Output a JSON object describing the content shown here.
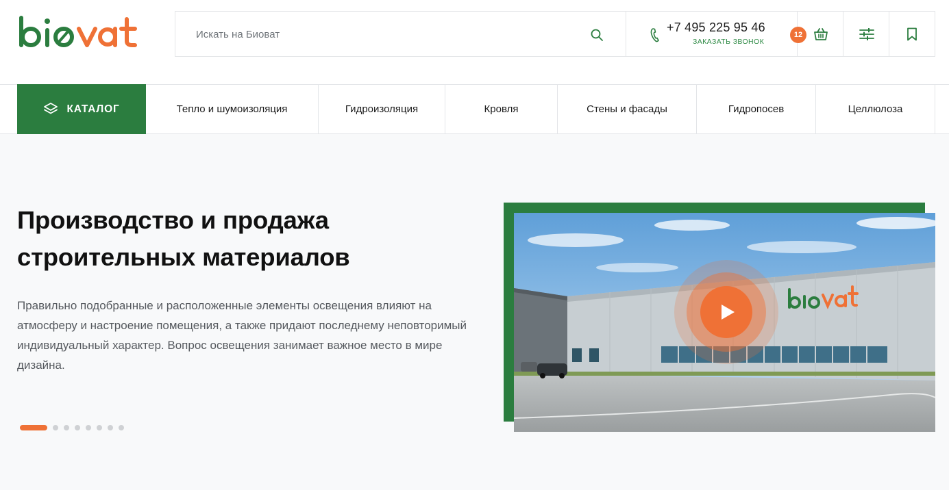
{
  "brand": {
    "logo_text": "biovat",
    "green": "#2b7d3f",
    "orange": "#ef7136"
  },
  "search": {
    "placeholder": "Искать на Биоват",
    "icon": "search-icon"
  },
  "contact": {
    "phone": "+7 495 225 95 46",
    "callback_label": "ЗАКАЗАТЬ ЗВОНОК",
    "icon": "phone-icon"
  },
  "tools": {
    "cart": {
      "icon": "basket-icon",
      "count": "12"
    },
    "compare": {
      "icon": "sliders-icon"
    },
    "favorites": {
      "icon": "bookmark-icon"
    }
  },
  "nav": {
    "catalog_label": "КАТАЛОГ",
    "catalog_icon": "layers-icon",
    "items": [
      {
        "label": "Тепло и шумоизоляция"
      },
      {
        "label": "Гидроизоляция"
      },
      {
        "label": "Кровля"
      },
      {
        "label": "Стены и фасады"
      },
      {
        "label": "Гидропосев"
      },
      {
        "label": "Целлюлоза"
      }
    ]
  },
  "hero": {
    "title": "Производство и продажа строительных материалов",
    "text": "Правильно подобранные и расположенные элементы освещения влияют на атмосферу и настроение помещения, а также придают последнему неповторимый индивидуальный характер. Вопрос освещения занимает важное место в мире дизайна.",
    "slides_total": 8,
    "active_slide": 1,
    "media": {
      "type": "video",
      "play_icon": "play-icon",
      "building_sign": "biovat"
    }
  }
}
